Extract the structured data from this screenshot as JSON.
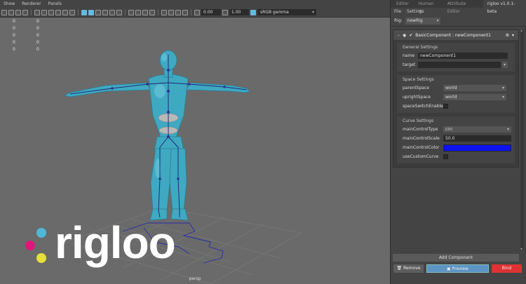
{
  "viewport": {
    "menu": [
      "Show",
      "Renderer",
      "Panels"
    ],
    "toolbar": {
      "field1": "0.00",
      "field2": "1.00",
      "colorspace": "sRGB gamma"
    },
    "hud_rows": [
      [
        "0",
        "0"
      ],
      [
        "0",
        "0"
      ],
      [
        "0",
        "0"
      ],
      [
        "0",
        "0"
      ],
      [
        "0",
        "0"
      ]
    ],
    "camera_label": "persp",
    "logo_text": "rigloo"
  },
  "panel": {
    "tabs": [
      "Editor",
      "Human IK",
      "Attribute Editor",
      "rigloo v1.0.1-beta"
    ],
    "menu": [
      "File",
      "Settings"
    ],
    "rig_label": "Rig:",
    "rig_value": "newRig",
    "component": {
      "title": "BasicComponent : newComponent1",
      "general": {
        "title": "General Settings",
        "name_label": "name",
        "name_value": "newComponent1",
        "target_label": "target",
        "target_value": ""
      },
      "space": {
        "title": "Space Settings",
        "parent_label": "parentSpace",
        "parent_value": "world",
        "upright_label": "uprightSpace",
        "upright_value": "world",
        "switch_label": "spaceSwitchEnabled"
      },
      "curve": {
        "title": "Curve Settings",
        "type_label": "mainControlType",
        "type_value": "circ",
        "scale_label": "mainControlScale",
        "scale_value": "50.0",
        "color_label": "mainControlColor",
        "color_hex": "#0d12f0",
        "custom_label": "useCustomCurve"
      }
    },
    "buttons": {
      "add": "Add Component",
      "remove": "Remove",
      "preview": "Preview",
      "bind": "Bind"
    }
  },
  "colors": {
    "accent": "#5bc0de",
    "bind": "#dd3333",
    "preview": "#5c94c3"
  }
}
